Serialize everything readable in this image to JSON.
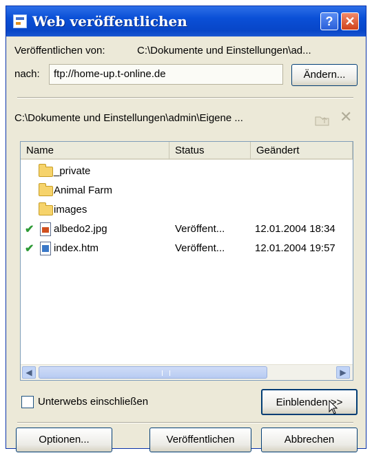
{
  "window": {
    "title": "Web veröffentlichen",
    "help_button": "?",
    "close_button": "✕"
  },
  "publish": {
    "from_label": "Veröffentlichen von:",
    "from_path": "C:\\Dokumente und Einstellungen\\ad...",
    "to_label": "nach:",
    "to_url": "ftp://home-up.t-online.de",
    "change_button": "Ändern..."
  },
  "folder_path": "C:\\Dokumente und Einstellungen\\admin\\Eigene ...",
  "columns": [
    "Name",
    "Status",
    "Geändert"
  ],
  "files": [
    {
      "name": "_private",
      "type": "folder",
      "published": false,
      "status": "",
      "modified": ""
    },
    {
      "name": "Animal Farm",
      "type": "folder",
      "published": false,
      "status": "",
      "modified": ""
    },
    {
      "name": "images",
      "type": "folder",
      "published": false,
      "status": "",
      "modified": ""
    },
    {
      "name": "albedo2.jpg",
      "type": "image-file",
      "published": true,
      "status": "Veröffent...",
      "modified": "12.01.2004 18:34"
    },
    {
      "name": "index.htm",
      "type": "html-file",
      "published": true,
      "status": "Veröffent...",
      "modified": "12.01.2004 19:57"
    }
  ],
  "options": {
    "include_subwebs_label": "Unterwebs einschließen",
    "include_subwebs_checked": false,
    "show_button": "Einblenden >>"
  },
  "footer": {
    "options_button": "Optionen...",
    "publish_button": "Veröffentlichen",
    "cancel_button": "Abbrechen"
  },
  "icons": {
    "check": "✔",
    "scroll_left": "◀",
    "scroll_right": "▶",
    "delete": "✕"
  },
  "colors": {
    "titlebar": "#0a4fd6",
    "dialog_bg": "#ece9d8",
    "published_check": "#2d9a35"
  }
}
